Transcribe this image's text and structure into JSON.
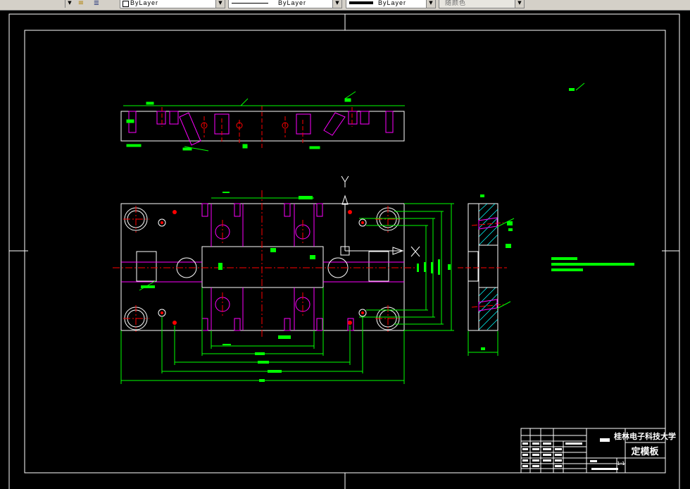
{
  "toolbar": {
    "color_combo": {
      "value": "ByLayer"
    },
    "linetype_combo": {
      "value": "ByLayer"
    },
    "lineweight_combo": {
      "value": "ByLayer"
    },
    "plotstyle_combo": {
      "value": "随颜色"
    }
  },
  "drawing": {
    "axis_y_label": "Y",
    "axis_x_label": "X",
    "title_block": {
      "school": "桂林电子科技大学",
      "part_name": "定模板",
      "scale": "1:1"
    }
  },
  "colors": {
    "background": "#000000",
    "frame": "#ffffff",
    "dimension": "#00ff00",
    "centerline": "#ff0000",
    "hidden": "#ff00ff",
    "hatch": "#00ffff"
  }
}
